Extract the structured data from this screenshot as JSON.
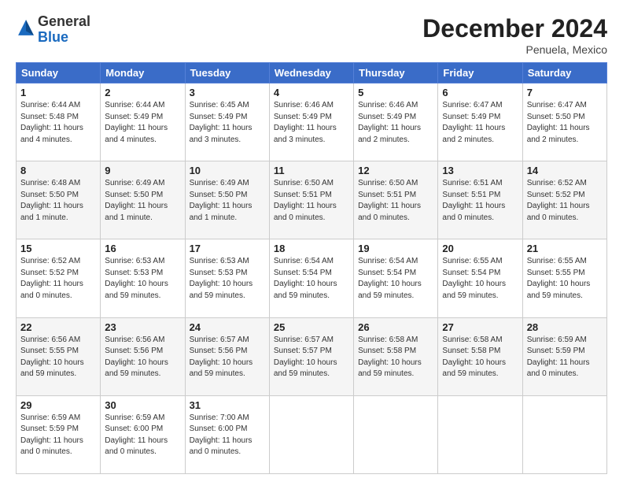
{
  "header": {
    "logo_general": "General",
    "logo_blue": "Blue",
    "month_title": "December 2024",
    "location": "Penuela, Mexico"
  },
  "days_of_week": [
    "Sunday",
    "Monday",
    "Tuesday",
    "Wednesday",
    "Thursday",
    "Friday",
    "Saturday"
  ],
  "weeks": [
    [
      {
        "day": "1",
        "info": "Sunrise: 6:44 AM\nSunset: 5:48 PM\nDaylight: 11 hours and 4 minutes."
      },
      {
        "day": "2",
        "info": "Sunrise: 6:44 AM\nSunset: 5:49 PM\nDaylight: 11 hours and 4 minutes."
      },
      {
        "day": "3",
        "info": "Sunrise: 6:45 AM\nSunset: 5:49 PM\nDaylight: 11 hours and 3 minutes."
      },
      {
        "day": "4",
        "info": "Sunrise: 6:46 AM\nSunset: 5:49 PM\nDaylight: 11 hours and 3 minutes."
      },
      {
        "day": "5",
        "info": "Sunrise: 6:46 AM\nSunset: 5:49 PM\nDaylight: 11 hours and 2 minutes."
      },
      {
        "day": "6",
        "info": "Sunrise: 6:47 AM\nSunset: 5:49 PM\nDaylight: 11 hours and 2 minutes."
      },
      {
        "day": "7",
        "info": "Sunrise: 6:47 AM\nSunset: 5:50 PM\nDaylight: 11 hours and 2 minutes."
      }
    ],
    [
      {
        "day": "8",
        "info": "Sunrise: 6:48 AM\nSunset: 5:50 PM\nDaylight: 11 hours and 1 minute."
      },
      {
        "day": "9",
        "info": "Sunrise: 6:49 AM\nSunset: 5:50 PM\nDaylight: 11 hours and 1 minute."
      },
      {
        "day": "10",
        "info": "Sunrise: 6:49 AM\nSunset: 5:50 PM\nDaylight: 11 hours and 1 minute."
      },
      {
        "day": "11",
        "info": "Sunrise: 6:50 AM\nSunset: 5:51 PM\nDaylight: 11 hours and 0 minutes."
      },
      {
        "day": "12",
        "info": "Sunrise: 6:50 AM\nSunset: 5:51 PM\nDaylight: 11 hours and 0 minutes."
      },
      {
        "day": "13",
        "info": "Sunrise: 6:51 AM\nSunset: 5:51 PM\nDaylight: 11 hours and 0 minutes."
      },
      {
        "day": "14",
        "info": "Sunrise: 6:52 AM\nSunset: 5:52 PM\nDaylight: 11 hours and 0 minutes."
      }
    ],
    [
      {
        "day": "15",
        "info": "Sunrise: 6:52 AM\nSunset: 5:52 PM\nDaylight: 11 hours and 0 minutes."
      },
      {
        "day": "16",
        "info": "Sunrise: 6:53 AM\nSunset: 5:53 PM\nDaylight: 10 hours and 59 minutes."
      },
      {
        "day": "17",
        "info": "Sunrise: 6:53 AM\nSunset: 5:53 PM\nDaylight: 10 hours and 59 minutes."
      },
      {
        "day": "18",
        "info": "Sunrise: 6:54 AM\nSunset: 5:54 PM\nDaylight: 10 hours and 59 minutes."
      },
      {
        "day": "19",
        "info": "Sunrise: 6:54 AM\nSunset: 5:54 PM\nDaylight: 10 hours and 59 minutes."
      },
      {
        "day": "20",
        "info": "Sunrise: 6:55 AM\nSunset: 5:54 PM\nDaylight: 10 hours and 59 minutes."
      },
      {
        "day": "21",
        "info": "Sunrise: 6:55 AM\nSunset: 5:55 PM\nDaylight: 10 hours and 59 minutes."
      }
    ],
    [
      {
        "day": "22",
        "info": "Sunrise: 6:56 AM\nSunset: 5:55 PM\nDaylight: 10 hours and 59 minutes."
      },
      {
        "day": "23",
        "info": "Sunrise: 6:56 AM\nSunset: 5:56 PM\nDaylight: 10 hours and 59 minutes."
      },
      {
        "day": "24",
        "info": "Sunrise: 6:57 AM\nSunset: 5:56 PM\nDaylight: 10 hours and 59 minutes."
      },
      {
        "day": "25",
        "info": "Sunrise: 6:57 AM\nSunset: 5:57 PM\nDaylight: 10 hours and 59 minutes."
      },
      {
        "day": "26",
        "info": "Sunrise: 6:58 AM\nSunset: 5:58 PM\nDaylight: 10 hours and 59 minutes."
      },
      {
        "day": "27",
        "info": "Sunrise: 6:58 AM\nSunset: 5:58 PM\nDaylight: 10 hours and 59 minutes."
      },
      {
        "day": "28",
        "info": "Sunrise: 6:59 AM\nSunset: 5:59 PM\nDaylight: 11 hours and 0 minutes."
      }
    ],
    [
      {
        "day": "29",
        "info": "Sunrise: 6:59 AM\nSunset: 5:59 PM\nDaylight: 11 hours and 0 minutes."
      },
      {
        "day": "30",
        "info": "Sunrise: 6:59 AM\nSunset: 6:00 PM\nDaylight: 11 hours and 0 minutes."
      },
      {
        "day": "31",
        "info": "Sunrise: 7:00 AM\nSunset: 6:00 PM\nDaylight: 11 hours and 0 minutes."
      },
      null,
      null,
      null,
      null
    ]
  ]
}
